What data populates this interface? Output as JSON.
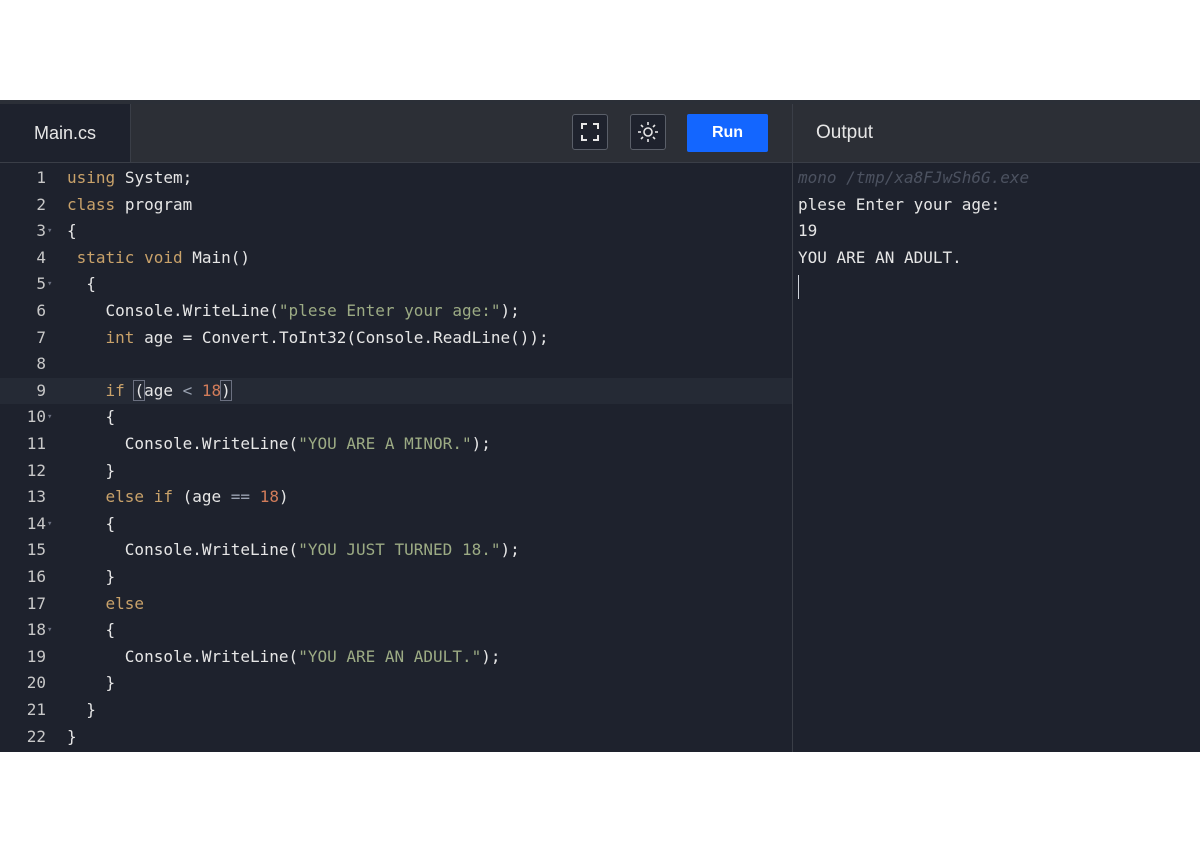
{
  "editor": {
    "tab_label": "Main.cs",
    "run_label": "Run",
    "fullscreen_icon": "fullscreen-icon",
    "theme_icon": "sun-icon"
  },
  "output": {
    "title": "Output",
    "lines": [
      "mono /tmp/xa8FJwSh6G.exe",
      "plese Enter your age:",
      "19",
      "YOU ARE AN ADULT."
    ]
  },
  "code": {
    "line_numbers": [
      "1",
      "2",
      "3",
      "4",
      "5",
      "6",
      "7",
      "8",
      "9",
      "10",
      "11",
      "12",
      "13",
      "14",
      "15",
      "16",
      "17",
      "18",
      "19",
      "20",
      "21",
      "22"
    ],
    "l1": [
      "using",
      "System;"
    ],
    "l2": [
      "class",
      "program"
    ],
    "l3": [
      "{"
    ],
    "l4": [
      "static",
      "void",
      "Main()"
    ],
    "l5": [
      "{"
    ],
    "l6": [
      "Console.WriteLine(",
      "\"plese Enter your age:\"",
      ");"
    ],
    "l7": [
      "int",
      "age = Convert.ToInt32(Console.ReadLine());"
    ],
    "l9": [
      "if",
      "(",
      "age",
      "<",
      "18",
      ")"
    ],
    "l10": [
      "{"
    ],
    "l11": [
      "Console.WriteLine(",
      "\"YOU ARE A MINOR.\"",
      ");"
    ],
    "l12": [
      "}"
    ],
    "l13": [
      "else if",
      "(age",
      "==",
      "18",
      ")"
    ],
    "l14": [
      "{"
    ],
    "l15": [
      "Console.WriteLine(",
      "\"YOU JUST TURNED 18.\"",
      ");"
    ],
    "l16": [
      "}"
    ],
    "l17": [
      "else"
    ],
    "l18": [
      "{"
    ],
    "l19": [
      "Console.WriteLine(",
      "\"YOU ARE AN ADULT.\"",
      ");"
    ],
    "l20": [
      "}"
    ],
    "l21": [
      "}"
    ],
    "l22": [
      "}"
    ]
  },
  "colors": {
    "run_button": "#1366ff",
    "keyword": "#c9a26a",
    "string": "#9cab84",
    "number": "#d27c5a"
  }
}
